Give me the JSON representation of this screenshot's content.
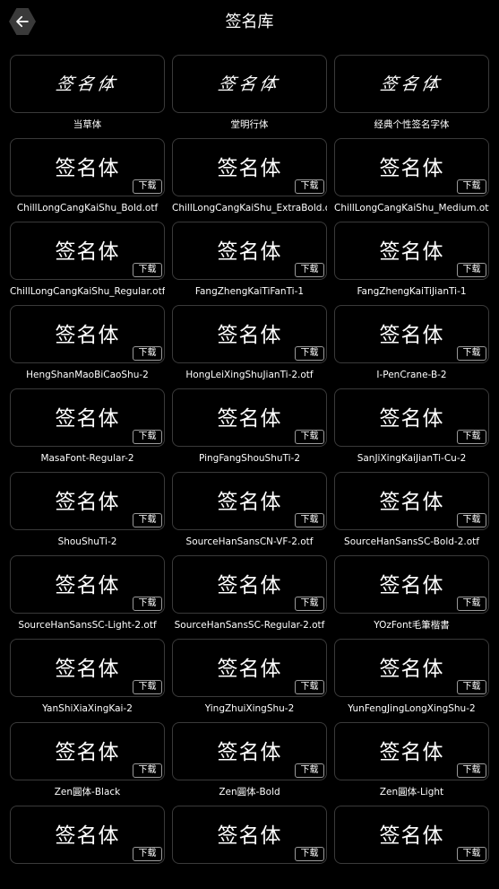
{
  "header": {
    "title": "签名库",
    "back_icon": "arrow-left-icon"
  },
  "download_label": "下载",
  "fonts": [
    {
      "preview": "签名体",
      "name": "当草体",
      "style": "script",
      "downloadable": false
    },
    {
      "preview": "签名体",
      "name": "堂明行体",
      "style": "script",
      "downloadable": false
    },
    {
      "preview": "签名体",
      "name": "经典个性签名字体",
      "style": "script",
      "downloadable": false
    },
    {
      "preview": "签名体",
      "name": "ChillLongCangKaiShu_Bold.otf",
      "style": "regular",
      "downloadable": true
    },
    {
      "preview": "签名体",
      "name": "ChillLongCangKaiShu_ExtraBold.otf",
      "style": "regular",
      "downloadable": true
    },
    {
      "preview": "签名体",
      "name": "ChillLongCangKaiShu_Medium.otf",
      "style": "regular",
      "downloadable": true
    },
    {
      "preview": "签名体",
      "name": "ChillLongCangKaiShu_Regular.otf",
      "style": "regular",
      "downloadable": true
    },
    {
      "preview": "签名体",
      "name": "FangZhengKaiTiFanTi-1",
      "style": "regular",
      "downloadable": true
    },
    {
      "preview": "签名体",
      "name": "FangZhengKaiTiJianTi-1",
      "style": "regular",
      "downloadable": true
    },
    {
      "preview": "签名体",
      "name": "HengShanMaoBiCaoShu-2",
      "style": "regular",
      "downloadable": true
    },
    {
      "preview": "签名体",
      "name": "HongLeiXingShuJianTi-2.otf",
      "style": "regular",
      "downloadable": true
    },
    {
      "preview": "签名体",
      "name": "I-PenCrane-B-2",
      "style": "regular",
      "downloadable": true
    },
    {
      "preview": "签名体",
      "name": "MasaFont-Regular-2",
      "style": "regular",
      "downloadable": true
    },
    {
      "preview": "签名体",
      "name": "PingFangShouShuTi-2",
      "style": "regular",
      "downloadable": true
    },
    {
      "preview": "签名体",
      "name": "SanJiXingKaiJianTi-Cu-2",
      "style": "regular",
      "downloadable": true
    },
    {
      "preview": "签名体",
      "name": "ShouShuTi-2",
      "style": "regular",
      "downloadable": true
    },
    {
      "preview": "签名体",
      "name": "SourceHanSansCN-VF-2.otf",
      "style": "regular",
      "downloadable": true
    },
    {
      "preview": "签名体",
      "name": "SourceHanSansSC-Bold-2.otf",
      "style": "regular",
      "downloadable": true
    },
    {
      "preview": "签名体",
      "name": "SourceHanSansSC-Light-2.otf",
      "style": "regular",
      "downloadable": true
    },
    {
      "preview": "签名体",
      "name": "SourceHanSansSC-Regular-2.otf",
      "style": "regular",
      "downloadable": true
    },
    {
      "preview": "签名体",
      "name": "YOzFont毛筆楷書",
      "style": "regular",
      "downloadable": true
    },
    {
      "preview": "签名体",
      "name": "YanShiXiaXingKai-2",
      "style": "regular",
      "downloadable": true
    },
    {
      "preview": "签名体",
      "name": "YingZhuiXingShu-2",
      "style": "regular",
      "downloadable": true
    },
    {
      "preview": "签名体",
      "name": "YunFengJingLongXingShu-2",
      "style": "regular",
      "downloadable": true
    },
    {
      "preview": "签名体",
      "name": "Zen圓体-Black",
      "style": "regular",
      "downloadable": true
    },
    {
      "preview": "签名体",
      "name": "Zen圓体-Bold",
      "style": "regular",
      "downloadable": true
    },
    {
      "preview": "签名体",
      "name": "Zen圓体-Light",
      "style": "regular",
      "downloadable": true
    },
    {
      "preview": "签名体",
      "name": "",
      "style": "regular",
      "downloadable": true
    },
    {
      "preview": "签名体",
      "name": "",
      "style": "regular",
      "downloadable": true
    },
    {
      "preview": "签名体",
      "name": "",
      "style": "regular",
      "downloadable": true
    }
  ]
}
